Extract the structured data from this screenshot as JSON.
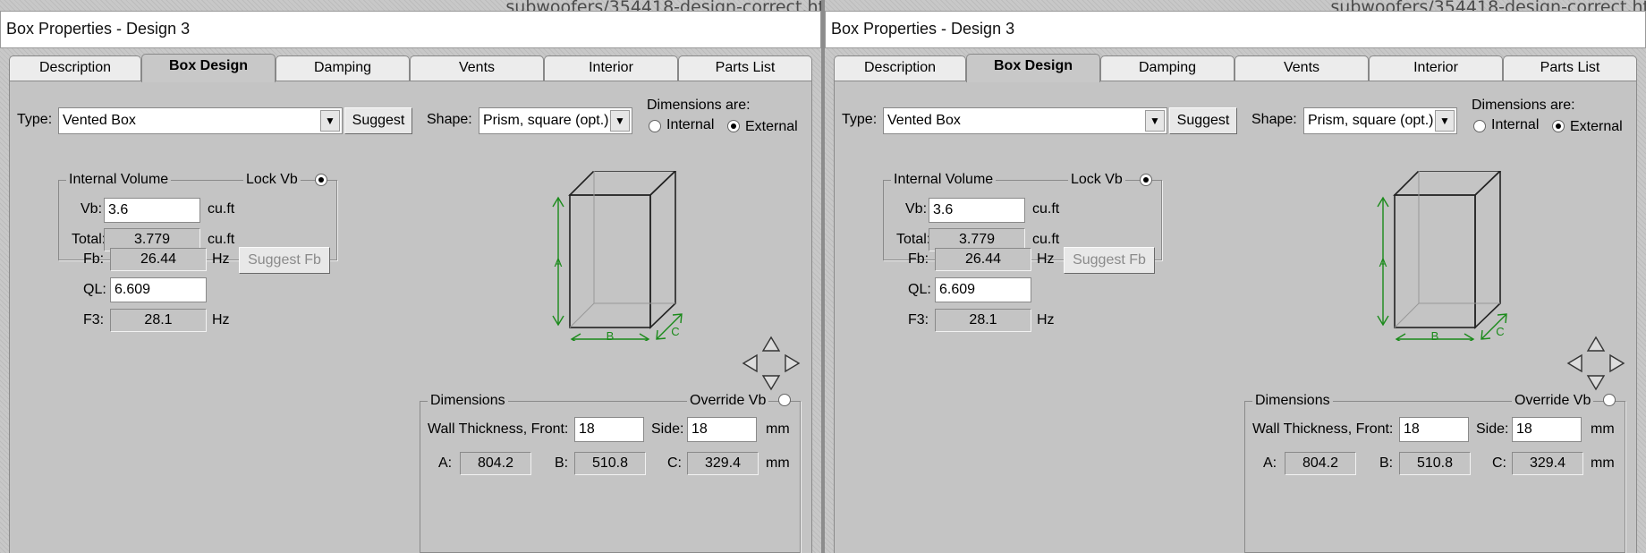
{
  "path_fragment": "subwoofers/354418-design-correct.ht",
  "window": {
    "title": "Box Properties - Design 3"
  },
  "tabs": [
    {
      "label": "Description"
    },
    {
      "label": "Box Design"
    },
    {
      "label": "Damping"
    },
    {
      "label": "Vents"
    },
    {
      "label": "Interior"
    },
    {
      "label": "Parts List"
    }
  ],
  "active_tab": "Box Design",
  "type": {
    "label": "Type:",
    "value": "Vented Box"
  },
  "suggest_label": "Suggest",
  "shape": {
    "label": "Shape:",
    "value": "Prism, square (opt.)"
  },
  "dimensions_are": {
    "label": "Dimensions are:",
    "internal": "Internal",
    "external": "External",
    "selected": "External"
  },
  "internal_volume": {
    "legend": "Internal Volume",
    "lock": "Lock Vb",
    "vb_label": "Vb:",
    "vb_value": "3.6",
    "vb_unit": "cu.ft",
    "total_label": "Total:",
    "total_value": "3.779",
    "total_unit": "cu.ft"
  },
  "tuning": {
    "fb_label": "Fb:",
    "fb_value": "26.44",
    "fb_unit": "Hz",
    "suggest_fb": "Suggest Fb",
    "ql_label": "QL:",
    "ql_value": "6.609",
    "f3_label": "F3:",
    "f3_value": "28.1",
    "f3_unit": "Hz"
  },
  "diagram": {
    "a_label": "A",
    "b_label": "B",
    "c_label": "C",
    "line_color": "#1a8a1a"
  },
  "dimensions": {
    "legend": "Dimensions",
    "override": "Override Vb",
    "wall_label": "Wall Thickness, Front:",
    "wall_front": "18",
    "side_label": "Side:",
    "wall_side": "18",
    "wall_unit": "mm",
    "a_label": "A:",
    "a_value": "804.2",
    "b_label": "B:",
    "b_value": "510.8",
    "c_label": "C:",
    "c_value": "329.4",
    "dim_unit": "mm"
  }
}
